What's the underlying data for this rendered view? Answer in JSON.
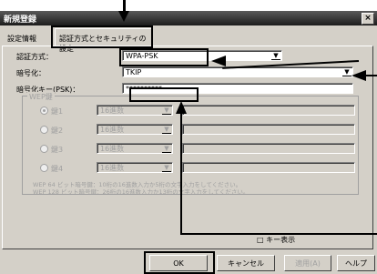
{
  "dialog": {
    "title": "新規登録",
    "close": "×"
  },
  "tabs": [
    "設定情報",
    "認証方式とセキュリティの設定"
  ],
  "fields": {
    "auth_label": "認証方式：",
    "auth_value": "WPA-PSK",
    "enc_label": "暗号化：",
    "enc_value": "TKIP",
    "key_label": "暗号化キー(PSK)：",
    "key_value": "**********"
  },
  "wep": {
    "group_label": "WEP鍵",
    "keys": [
      {
        "label": "鍵1",
        "format": "16進数"
      },
      {
        "label": "鍵2",
        "format": "16進数"
      },
      {
        "label": "鍵3",
        "format": "16進数"
      },
      {
        "label": "鍵4",
        "format": "16進数"
      }
    ],
    "note1": "WEP 64 ビット暗号鍵：10桁の16進数入力か5桁の文字入力をしてください。",
    "note2": "WEP 128 ビット暗号鍵：26桁の16進数入力か13桁の文字入力をしてください。"
  },
  "show_key": "キー表示",
  "buttons": {
    "ok": "OK",
    "cancel": "キャンセル",
    "apply": "適用(A)",
    "help": "ヘルプ"
  }
}
